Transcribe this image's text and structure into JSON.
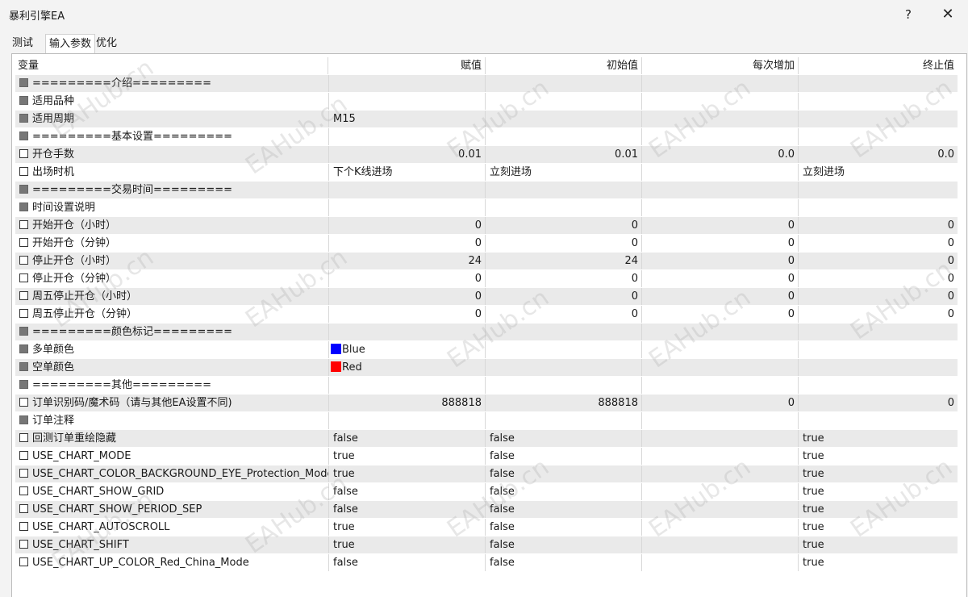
{
  "window": {
    "title": "暴利引擎EA",
    "help_label": "?",
    "close_label": "✕"
  },
  "tabs": [
    "测试",
    "输入参数",
    "优化"
  ],
  "columns": [
    "变量",
    "赋值",
    "初始值",
    "每次增加",
    "终止值"
  ],
  "colors": {
    "blue": "#0000ff",
    "red": "#ff0000"
  },
  "rows": [
    {
      "name": "=========介绍=========",
      "v": "",
      "s": "",
      "step": "",
      "e": ""
    },
    {
      "name": "适用品种",
      "v": "",
      "s": "",
      "step": "",
      "e": ""
    },
    {
      "name": "适用周期",
      "v": "M15",
      "s": "",
      "step": "",
      "e": ""
    },
    {
      "name": "=========基本设置=========",
      "v": "",
      "s": "",
      "step": "",
      "e": ""
    },
    {
      "name": "开仓手数",
      "v": "0.01",
      "s": "0.01",
      "step": "0.0",
      "e": "0.0"
    },
    {
      "name": "出场时机",
      "v": "下个K线进场",
      "s": "立刻进场",
      "step": "",
      "e": "立刻进场"
    },
    {
      "name": "=========交易时间=========",
      "v": "",
      "s": "",
      "step": "",
      "e": ""
    },
    {
      "name": "时间设置说明",
      "v": "",
      "s": "",
      "step": "",
      "e": ""
    },
    {
      "name": "开始开仓（小时）",
      "v": "0",
      "s": "0",
      "step": "0",
      "e": "0"
    },
    {
      "name": "开始开仓（分钟）",
      "v": "0",
      "s": "0",
      "step": "0",
      "e": "0"
    },
    {
      "name": "停止开仓（小时）",
      "v": "24",
      "s": "24",
      "step": "0",
      "e": "0"
    },
    {
      "name": "停止开仓（分钟）",
      "v": "0",
      "s": "0",
      "step": "0",
      "e": "0"
    },
    {
      "name": "周五停止开仓（小时）",
      "v": "0",
      "s": "0",
      "step": "0",
      "e": "0"
    },
    {
      "name": "周五停止开仓（分钟）",
      "v": "0",
      "s": "0",
      "step": "0",
      "e": "0"
    },
    {
      "name": "=========颜色标记=========",
      "v": "",
      "s": "",
      "step": "",
      "e": ""
    },
    {
      "name": "多单颜色",
      "v": "Blue",
      "s": "",
      "step": "",
      "e": ""
    },
    {
      "name": "空单颜色",
      "v": "Red",
      "s": "",
      "step": "",
      "e": ""
    },
    {
      "name": "=========其他=========",
      "v": "",
      "s": "",
      "step": "",
      "e": ""
    },
    {
      "name": "订单识别码/魔术码（请与其他EA设置不同)",
      "v": "888818",
      "s": "888818",
      "step": "0",
      "e": "0"
    },
    {
      "name": "订单注释",
      "v": "",
      "s": "",
      "step": "",
      "e": ""
    },
    {
      "name": "回测订单重绘隐藏",
      "v": "false",
      "s": "false",
      "step": "",
      "e": "true"
    },
    {
      "name": "USE_CHART_MODE",
      "v": "true",
      "s": "false",
      "step": "",
      "e": "true"
    },
    {
      "name": "USE_CHART_COLOR_BACKGROUND_EYE_Protection_Mode",
      "v": "true",
      "s": "false",
      "step": "",
      "e": "true"
    },
    {
      "name": "USE_CHART_SHOW_GRID",
      "v": "false",
      "s": "false",
      "step": "",
      "e": "true"
    },
    {
      "name": "USE_CHART_SHOW_PERIOD_SEP",
      "v": "false",
      "s": "false",
      "step": "",
      "e": "true"
    },
    {
      "name": "USE_CHART_AUTOSCROLL",
      "v": "true",
      "s": "false",
      "step": "",
      "e": "true"
    },
    {
      "name": "USE_CHART_SHIFT",
      "v": "true",
      "s": "false",
      "step": "",
      "e": "true"
    },
    {
      "name": "USE_CHART_UP_COLOR_Red_China_Mode",
      "v": "false",
      "s": "false",
      "step": "",
      "e": "true"
    }
  ],
  "watermark": "EAHub.cn"
}
